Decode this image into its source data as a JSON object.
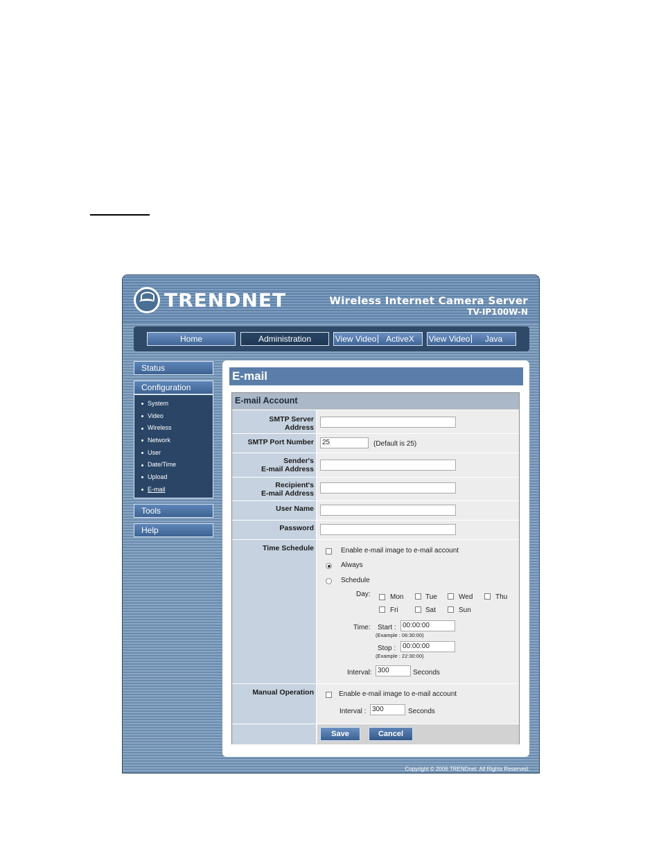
{
  "header": {
    "brand": "TRENDNET",
    "product_title": "Wireless Internet Camera Server",
    "product_model": "TV-IP100W-N"
  },
  "nav": {
    "home": "Home",
    "administration": "Administration",
    "view_video_activex": [
      "View Video",
      "ActiveX"
    ],
    "view_video_java": [
      "View Video",
      "Java"
    ]
  },
  "sidebar": {
    "status": "Status",
    "configuration": "Configuration",
    "config_items": [
      "System",
      "Video",
      "Wireless",
      "Network",
      "User",
      "Date/Time",
      "Upload",
      "E-mail"
    ],
    "tools": "Tools",
    "help": "Help"
  },
  "page": {
    "title": "E-mail",
    "section": "E-mail Account"
  },
  "form": {
    "smtp_server_label": [
      "SMTP Server",
      "Address"
    ],
    "smtp_server_value": "",
    "smtp_port_label": "SMTP Port Number",
    "smtp_port_value": "25",
    "smtp_port_hint": "(Default is 25)",
    "sender_label": [
      "Sender's",
      "E-mail Address"
    ],
    "sender_value": "",
    "recipient_label": [
      "Recipient's",
      "E-mail Address"
    ],
    "recipient_value": "",
    "username_label": "User Name",
    "username_value": "",
    "password_label": "Password",
    "password_value": "",
    "time_schedule_label": "Time Schedule",
    "enable_schedule_text": "Enable e-mail image to e-mail account",
    "always_text": "Always",
    "schedule_text": "Schedule",
    "day_label": "Day:",
    "days": [
      "Mon",
      "Tue",
      "Wed",
      "Thu",
      "Fri",
      "Sat",
      "Sun"
    ],
    "time_label": "Time:",
    "start_label": "Start :",
    "start_value": "00:00:00",
    "start_example": "(Example : 06:30:00)",
    "stop_label": "Stop :",
    "stop_value": "00:00:00",
    "stop_example": "(Example : 22:30:00)",
    "interval_label": "Interval:",
    "interval_value": "300",
    "seconds_text": "Seconds",
    "manual_label": "Manual Operation",
    "enable_manual_text": "Enable e-mail image to e-mail account",
    "manual_interval_label": "Interval :",
    "manual_interval_value": "300",
    "manual_seconds_text": "Seconds",
    "save_label": "Save",
    "cancel_label": "Cancel"
  },
  "footer": {
    "copyright": "Copyright © 2006 TRENDnet. All Rights Reserved."
  },
  "colors": {
    "frame_blue": "#6b8bad",
    "title_bar": "#5a7ea9",
    "nav_dark": "#2f4a68",
    "label_cell": "#c6d2df"
  }
}
